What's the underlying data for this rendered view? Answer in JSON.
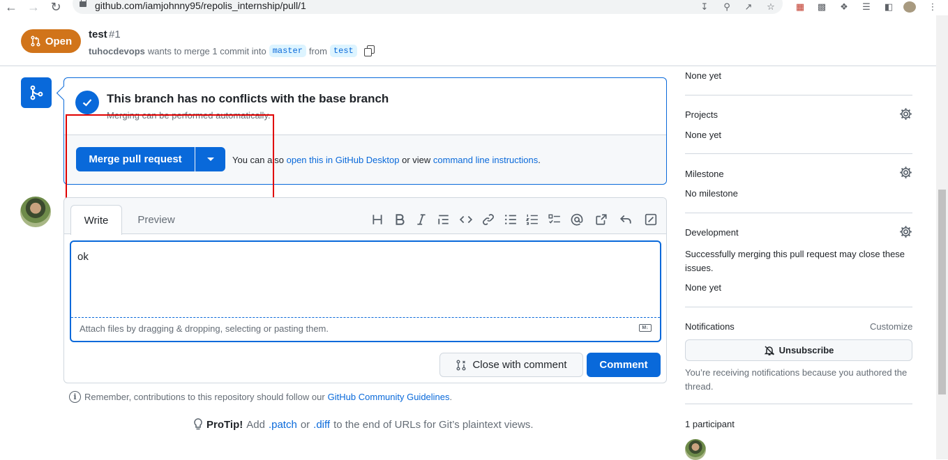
{
  "browser": {
    "url": "github.com/iamjohnny95/repolis_internship/pull/1"
  },
  "pr": {
    "state": "Open",
    "title": "test",
    "number": "#1",
    "author": "tuhocdevops",
    "meta_mid": "wants to merge 1 commit into",
    "base_branch": "master",
    "from_word": "from",
    "head_branch": "test"
  },
  "merge": {
    "title": "This branch has no conflicts with the base branch",
    "subtitle": "Merging can be performed automatically.",
    "button": "Merge pull request",
    "alt_prefix": "You can also",
    "alt_link1": "open this in GitHub Desktop",
    "alt_mid": "or view",
    "alt_link2": "command line instructions",
    "alt_end": "."
  },
  "comment": {
    "tab_write": "Write",
    "tab_preview": "Preview",
    "text": "ok",
    "attach_hint": "Attach files by dragging & dropping, selecting or pasting them.",
    "close_button": "Close with comment",
    "comment_button": "Comment",
    "markdown_badge": "M↓"
  },
  "footer": {
    "guidelines_prefix": "Remember, contributions to this repository should follow our",
    "guidelines_link": "GitHub Community Guidelines",
    "guidelines_end": ".",
    "protip_label": "ProTip!",
    "protip_a": "Add",
    "protip_patch": ".patch",
    "protip_or": "or",
    "protip_diff": ".diff",
    "protip_rest": "to the end of URLs for Git’s plaintext views."
  },
  "sidebar": {
    "top_value": "None yet",
    "projects_label": "Projects",
    "projects_value": "None yet",
    "milestone_label": "Milestone",
    "milestone_value": "No milestone",
    "development_label": "Development",
    "development_desc": "Successfully merging this pull request may close these issues.",
    "development_value": "None yet",
    "notifications_label": "Notifications",
    "customize": "Customize",
    "unsubscribe": "Unsubscribe",
    "notification_reason": "You’re receiving notifications because you authored the thread.",
    "participants": "1 participant"
  },
  "colors": {
    "open_badge": "#d1741a",
    "primary": "#0969da",
    "highlight_box": "#e00000"
  }
}
